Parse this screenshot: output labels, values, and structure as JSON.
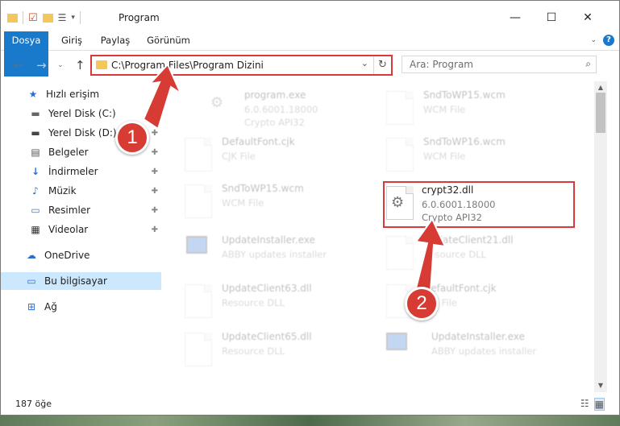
{
  "window": {
    "title": "Program",
    "controls": {
      "minimize": "—",
      "maximize": "☐",
      "close": "✕"
    }
  },
  "ribbon": {
    "tabs": [
      "Dosya",
      "Giriş",
      "Paylaş",
      "Görünüm"
    ],
    "help": "?"
  },
  "address": {
    "path": "C:\\Program Files\\Program Dizini",
    "search_placeholder": "Ara: Program"
  },
  "nav": {
    "quick_access": "Hızlı erişim",
    "items": [
      {
        "label": "Yerel Disk (C:)",
        "icon": "drive-icon",
        "pinned": true
      },
      {
        "label": "Yerel Disk (D:)",
        "icon": "drive-icon",
        "pinned": true
      },
      {
        "label": "Belgeler",
        "icon": "documents-icon",
        "pinned": true
      },
      {
        "label": "İndirmeler",
        "icon": "downloads-icon",
        "pinned": true
      },
      {
        "label": "Müzik",
        "icon": "music-icon",
        "pinned": true
      },
      {
        "label": "Resimler",
        "icon": "pictures-icon",
        "pinned": true
      },
      {
        "label": "Videolar",
        "icon": "videos-icon",
        "pinned": true
      }
    ],
    "onedrive": "OneDrive",
    "this_pc": "Bu bilgisayar",
    "network": "Ağ"
  },
  "files": [
    {
      "name": "program.exe",
      "l2": "6.0.6001.18000",
      "l3": "Crypto API32"
    },
    {
      "name": "SndToWP15.wcm",
      "l2": "WCM File",
      "l3": ""
    },
    {
      "name": "DefaultFont.cjk",
      "l2": "CJK File",
      "l3": ""
    },
    {
      "name": "SndToWP16.wcm",
      "l2": "WCM File",
      "l3": ""
    },
    {
      "name": "SndToWP15.wcm",
      "l2": "WCM File",
      "l3": ""
    },
    {
      "name": "crypt32.dll",
      "l2": "6.0.6001.18000",
      "l3": "Crypto API32"
    },
    {
      "name": "UpdateInstaller.exe",
      "l2": "ABBY updates installer",
      "l3": ""
    },
    {
      "name": "UpdateClient21.dll",
      "l2": "Resource DLL",
      "l3": ""
    },
    {
      "name": "UpdateClient63.dll",
      "l2": "Resource DLL",
      "l3": ""
    },
    {
      "name": "DefaultFont.cjk",
      "l2": "CJK File",
      "l3": ""
    },
    {
      "name": "UpdateClient65.dll",
      "l2": "Resource DLL",
      "l3": ""
    },
    {
      "name": "UpdateInstaller.exe",
      "l2": "ABBY updates installer",
      "l3": ""
    }
  ],
  "status": {
    "count": "187 öğe"
  },
  "annotations": {
    "step1": "1",
    "step2": "2",
    "color": "#d63b34"
  }
}
